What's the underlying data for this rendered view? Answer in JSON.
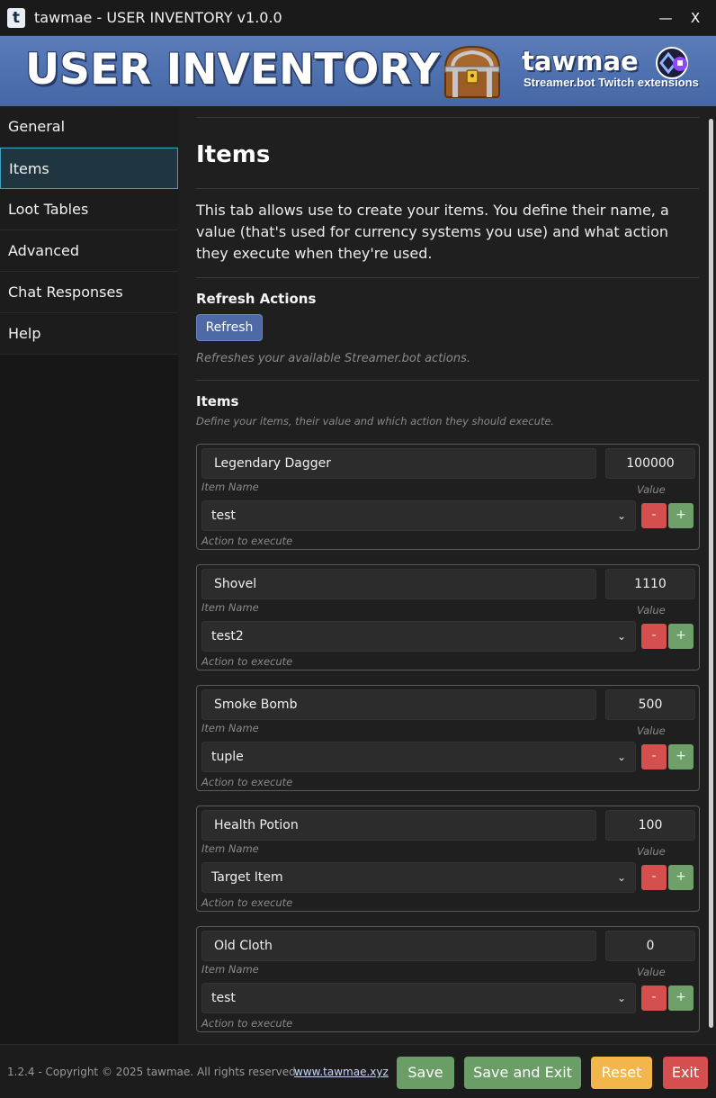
{
  "window": {
    "icon_letter": "t",
    "title": "tawmae - USER INVENTORY v1.0.0",
    "minimize": "—",
    "close": "X"
  },
  "banner": {
    "title": "USER INVENTORY",
    "brand": "tawmae",
    "subtitle": "Streamer.bot Twitch extensions"
  },
  "sidebar": {
    "items": [
      {
        "label": "General"
      },
      {
        "label": "Items",
        "active": true
      },
      {
        "label": "Loot Tables"
      },
      {
        "label": "Advanced"
      },
      {
        "label": "Chat Responses"
      },
      {
        "label": "Help"
      }
    ]
  },
  "main": {
    "heading": "Items",
    "description": "This tab allows use to create your items. You define their name, a value (that's used for currency systems you use) and what action they execute when they're used.",
    "refresh": {
      "title": "Refresh Actions",
      "button": "Refresh",
      "hint": "Refreshes your available Streamer.bot actions."
    },
    "items_section": {
      "title": "Items",
      "hint": "Define your items, their value and which action they should execute.",
      "labels": {
        "name": "Item Name",
        "value": "Value",
        "action": "Action to execute",
        "remove": "-",
        "add": "+"
      },
      "entries": [
        {
          "name": "Legendary Dagger",
          "value": "100000",
          "action": "test"
        },
        {
          "name": "Shovel",
          "value": "1110",
          "action": "test2"
        },
        {
          "name": "Smoke Bomb",
          "value": "500",
          "action": "tuple"
        },
        {
          "name": "Health Potion",
          "value": "100",
          "action": "Target Item"
        },
        {
          "name": "Old Cloth",
          "value": "0",
          "action": "test"
        }
      ]
    }
  },
  "footer": {
    "copyright": "1.2.4 - Copyright © 2025 tawmae. All rights reserved.",
    "link": "www.tawmae.xyz",
    "buttons": {
      "save": "Save",
      "save_exit": "Save and Exit",
      "reset": "Reset",
      "exit": "Exit"
    }
  },
  "colors": {
    "accent_active": "#3ea1c4",
    "banner_blue": "#4d6fae",
    "save_green": "#6a9e66",
    "reset_orange": "#f2b64a",
    "exit_red": "#d64f4f"
  }
}
